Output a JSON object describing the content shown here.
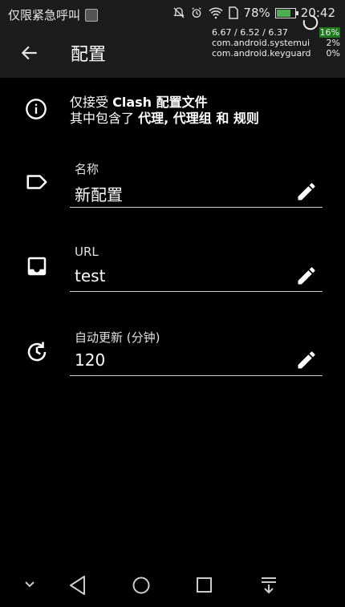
{
  "status_bar": {
    "carrier": "仅限紧急呼叫",
    "battery_percent": "78%",
    "battery_level": 0.78,
    "time": "20:42"
  },
  "perf_overlay": {
    "load": "6.67 / 6.52 / 6.37",
    "cpu_total": "16%",
    "process_1_name": "com.android.systemui",
    "process_1_pct": "2%",
    "process_2_name": "com.android.keyguard",
    "process_2_pct": "0%"
  },
  "appbar": {
    "title": "配置"
  },
  "info": {
    "line1_prefix": "仅接受 ",
    "line1_bold": "Clash 配置文件",
    "line2_prefix": "其中包含了 ",
    "line2_bold": "代理, 代理组 和 规则"
  },
  "fields": [
    {
      "label": "名称",
      "value": "新配置",
      "icon": "label-icon"
    },
    {
      "label": "URL",
      "value": "test",
      "icon": "inbox-icon"
    },
    {
      "label": "自动更新 (分钟)",
      "value": "120",
      "icon": "history-icon"
    }
  ],
  "navbar": {
    "icons": [
      "chevron-down-icon",
      "back-icon",
      "home-icon",
      "recents-icon",
      "notifications-pull-icon"
    ]
  }
}
